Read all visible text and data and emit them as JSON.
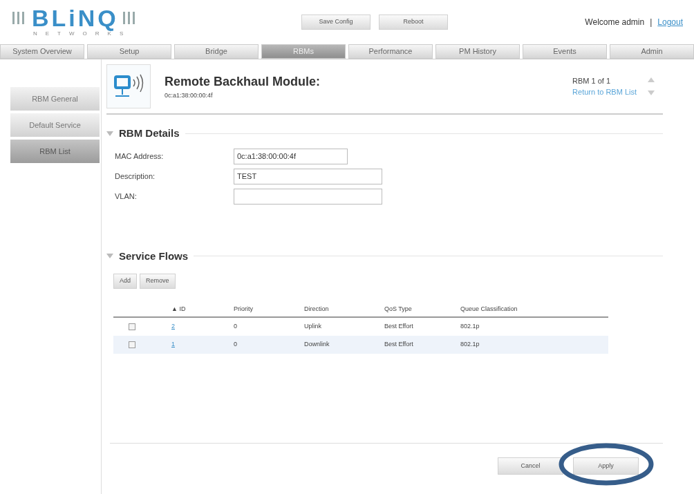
{
  "logo": {
    "name": "BLiNQ",
    "tagline": "NETWORKS"
  },
  "header_buttons": [
    "Save Config",
    "Reboot"
  ],
  "welcome": {
    "text": "Welcome admin",
    "separator": "|",
    "link": "Logout"
  },
  "tabs": [
    {
      "label": "System Overview",
      "selected": false
    },
    {
      "label": "Setup",
      "selected": false
    },
    {
      "label": "Bridge",
      "selected": false
    },
    {
      "label": "RBMs",
      "selected": true
    },
    {
      "label": "Performance",
      "selected": false
    },
    {
      "label": "PM History",
      "selected": false
    },
    {
      "label": "Events",
      "selected": false
    },
    {
      "label": "Admin",
      "selected": false
    }
  ],
  "sidebar": {
    "items": [
      {
        "label": "RBM General",
        "selected": false
      },
      {
        "label": "Default Service",
        "selected": false
      },
      {
        "label": "RBM List",
        "selected": true
      }
    ]
  },
  "module": {
    "title": "Remote Backhaul Module:",
    "mac": "0c:a1:38:00:00:4f",
    "counter": "RBM 1 of 1",
    "return_link": "Return to RBM List"
  },
  "rbm_details": {
    "title": "RBM Details",
    "fields": [
      {
        "label": "MAC Address:",
        "value": "0c:a1:38:00:00:4f"
      },
      {
        "label": "Description:",
        "value": "TEST"
      },
      {
        "label": "VLAN:"
      }
    ]
  },
  "service_flows": {
    "title": "Service Flows",
    "buttons": [
      "Add",
      "Remove"
    ],
    "columns": [
      "▲ ID",
      "Priority",
      "Direction",
      "QoS Type",
      "Queue Classification"
    ],
    "rows": [
      {
        "checked": false,
        "id": "2",
        "priority": "0",
        "direction": "Uplink",
        "qos_type": "Best Effort",
        "queue": "802.1p"
      },
      {
        "checked": false,
        "id": "1",
        "priority": "0",
        "direction": "Downlink",
        "qos_type": "Best Effort",
        "queue": "802.1p"
      }
    ]
  },
  "footer_buttons": [
    {
      "label": "Cancel",
      "circled": false
    },
    {
      "label": "Apply",
      "circled": true
    }
  ]
}
